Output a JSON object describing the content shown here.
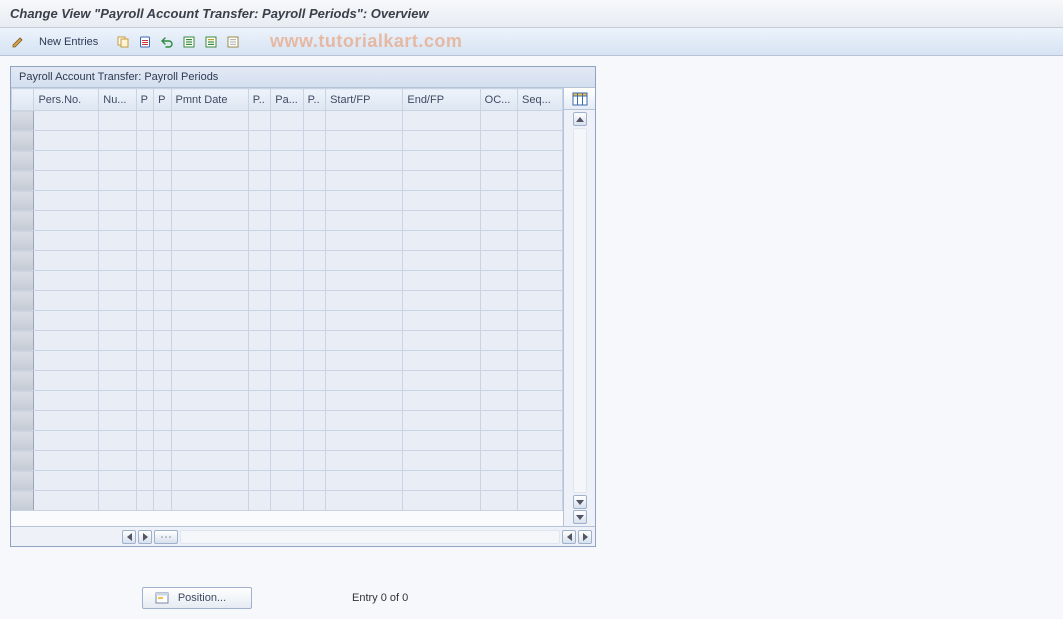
{
  "title": "Change View \"Payroll Account Transfer: Payroll Periods\": Overview",
  "toolbar": {
    "new_entries_label": "New Entries"
  },
  "watermark": "www.tutorialkart.com",
  "panel": {
    "title": "Payroll Account Transfer: Payroll Periods",
    "columns": [
      "Pers.No.",
      "Nu...",
      "P",
      "P",
      "Pmnt Date",
      "P..",
      "Pa...",
      "P..",
      "Start/FP",
      "End/FP",
      "OC...",
      "Seq..."
    ],
    "rows": [
      [
        "",
        "",
        "",
        "",
        "",
        "",
        "",
        "",
        "",
        "",
        "",
        ""
      ],
      [
        "",
        "",
        "",
        "",
        "",
        "",
        "",
        "",
        "",
        "",
        "",
        ""
      ],
      [
        "",
        "",
        "",
        "",
        "",
        "",
        "",
        "",
        "",
        "",
        "",
        ""
      ],
      [
        "",
        "",
        "",
        "",
        "",
        "",
        "",
        "",
        "",
        "",
        "",
        ""
      ],
      [
        "",
        "",
        "",
        "",
        "",
        "",
        "",
        "",
        "",
        "",
        "",
        ""
      ],
      [
        "",
        "",
        "",
        "",
        "",
        "",
        "",
        "",
        "",
        "",
        "",
        ""
      ],
      [
        "",
        "",
        "",
        "",
        "",
        "",
        "",
        "",
        "",
        "",
        "",
        ""
      ],
      [
        "",
        "",
        "",
        "",
        "",
        "",
        "",
        "",
        "",
        "",
        "",
        ""
      ],
      [
        "",
        "",
        "",
        "",
        "",
        "",
        "",
        "",
        "",
        "",
        "",
        ""
      ],
      [
        "",
        "",
        "",
        "",
        "",
        "",
        "",
        "",
        "",
        "",
        "",
        ""
      ],
      [
        "",
        "",
        "",
        "",
        "",
        "",
        "",
        "",
        "",
        "",
        "",
        ""
      ],
      [
        "",
        "",
        "",
        "",
        "",
        "",
        "",
        "",
        "",
        "",
        "",
        ""
      ],
      [
        "",
        "",
        "",
        "",
        "",
        "",
        "",
        "",
        "",
        "",
        "",
        ""
      ],
      [
        "",
        "",
        "",
        "",
        "",
        "",
        "",
        "",
        "",
        "",
        "",
        ""
      ],
      [
        "",
        "",
        "",
        "",
        "",
        "",
        "",
        "",
        "",
        "",
        "",
        ""
      ],
      [
        "",
        "",
        "",
        "",
        "",
        "",
        "",
        "",
        "",
        "",
        "",
        ""
      ],
      [
        "",
        "",
        "",
        "",
        "",
        "",
        "",
        "",
        "",
        "",
        "",
        ""
      ],
      [
        "",
        "",
        "",
        "",
        "",
        "",
        "",
        "",
        "",
        "",
        "",
        ""
      ],
      [
        "",
        "",
        "",
        "",
        "",
        "",
        "",
        "",
        "",
        "",
        "",
        ""
      ],
      [
        "",
        "",
        "",
        "",
        "",
        "",
        "",
        "",
        "",
        "",
        "",
        ""
      ]
    ]
  },
  "footer": {
    "position_label": "Position...",
    "entry_text": "Entry 0 of 0"
  }
}
